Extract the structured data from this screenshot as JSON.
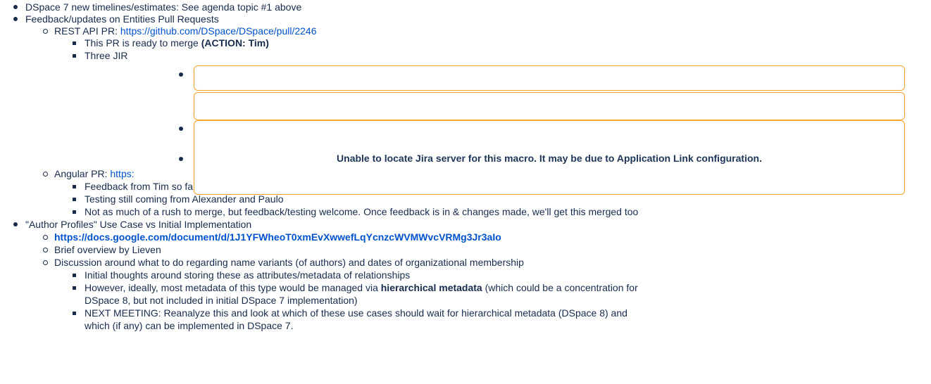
{
  "items": {
    "i1": "DSpace 7 new timelines/estimates: See agenda topic #1 above",
    "i2": "Feedback/updates on Entities Pull Requests",
    "i2a_prefix": "REST API PR: ",
    "i2a_link": "https://github.com/DSpace/DSpace/pull/2246",
    "i2a1_prefix": "This PR is ready to merge ",
    "i2a1_bold": "(ACTION: Tim)",
    "i2a2_prefix": "Three JIR",
    "i2b_prefix": "Angular PR: ",
    "i2b_link": "https:",
    "i2b1": "Feedback from Tim so far. Discussion over a few topics ongoing (and pending changes)",
    "i2b2": "Testing still coming from Alexander and Paulo",
    "i2b3": "Not as much of a rush to merge, but feedback/testing welcome. Once feedback is in & changes made, we'll get this merged too",
    "i3": "\"Author Profiles\" Use Case vs Initial Implementation",
    "i3a_link": "https://docs.google.com/document/d/1J1YFWheoT0xmEvXwwefLqYcnzcWVMWvcVRMg3Jr3aIo",
    "i3b": "Brief overview by Lieven",
    "i3c": "Discussion around what to do regarding name variants (of authors) and dates of organizational membership",
    "i3c1": "Initial thoughts around storing these as attributes/metadata of relationships",
    "i3c2_prefix": "However, ideally, most metadata of this type would be managed via ",
    "i3c2_bold": "hierarchical metadata",
    "i3c2_suffix": " (which could be a concentration for",
    "i3c2_line2": "DSpace 8, but not included in initial DSpace 7 implementation)",
    "i3c3_line1": "NEXT MEETING: Reanalyze this and look at which of these use cases should wait for hierarchical metadata (DSpace 8) and",
    "i3c3_line2": "which (if any) can be implemented in DSpace 7."
  },
  "jira": {
    "error_message": "Unable to locate Jira server for this macro. It may be due to Application Link configuration."
  },
  "colors": {
    "text": "#172b4d",
    "link": "#0052cc",
    "jira_border": "#f5a623"
  }
}
